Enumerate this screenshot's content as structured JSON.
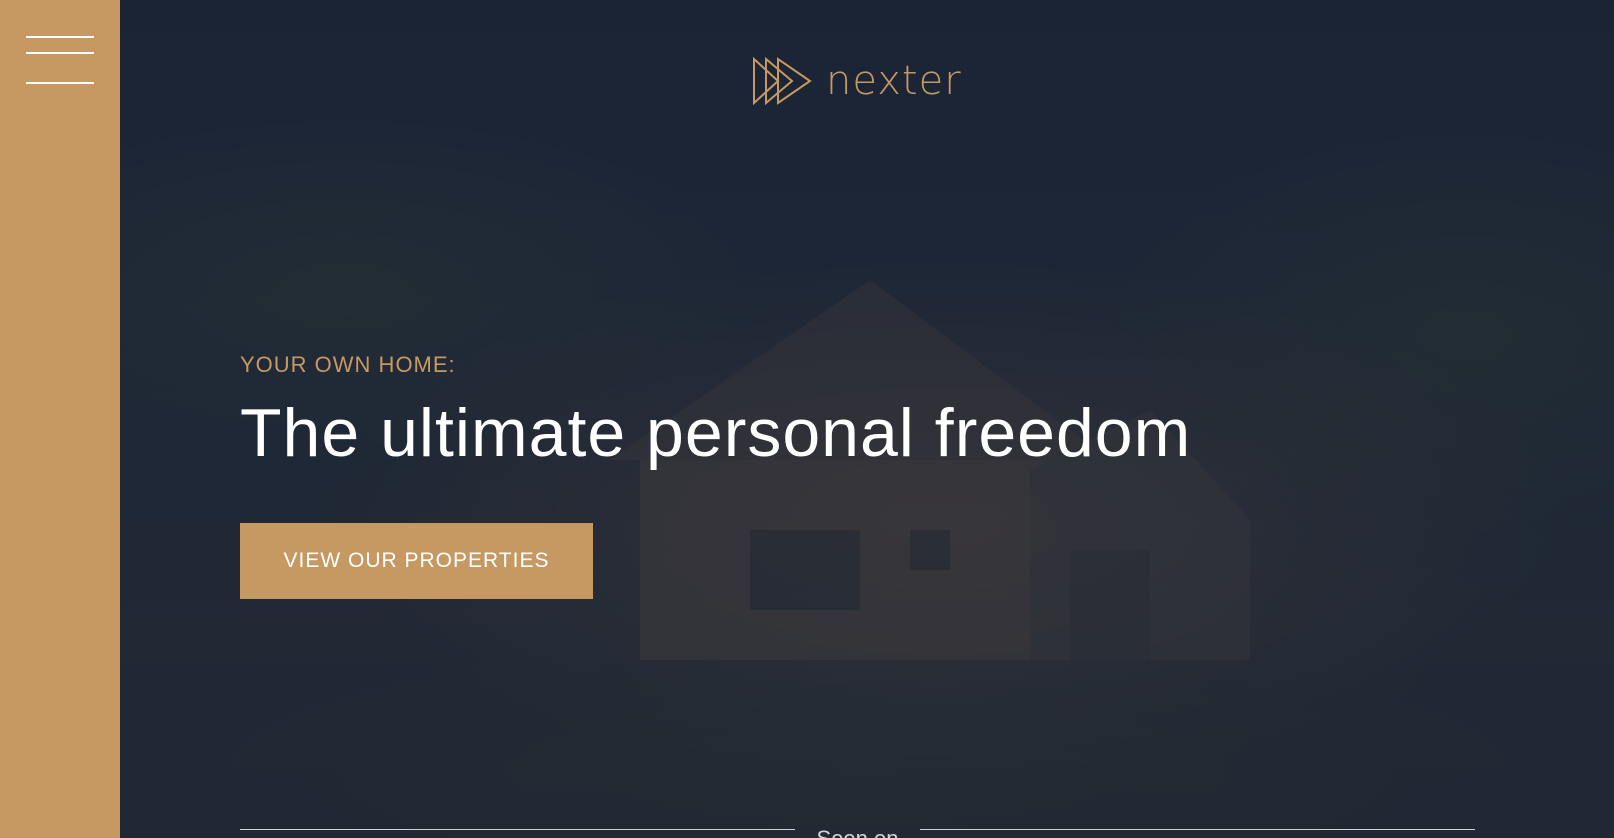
{
  "nav": {
    "menu_icon": "hamburger-icon"
  },
  "brand": {
    "name": "nexter",
    "logo_icon": "triple-play-arrow-icon",
    "color": "#c69963"
  },
  "hero": {
    "subtitle": "YOUR OWN HOME:",
    "title": "The ultimate personal freedom",
    "cta_label": "VIEW OUR PROPERTIES"
  },
  "seen_on": {
    "label": "Seen on"
  },
  "colors": {
    "accent": "#c69963",
    "background": "#1c2536",
    "text": "#ffffff"
  }
}
